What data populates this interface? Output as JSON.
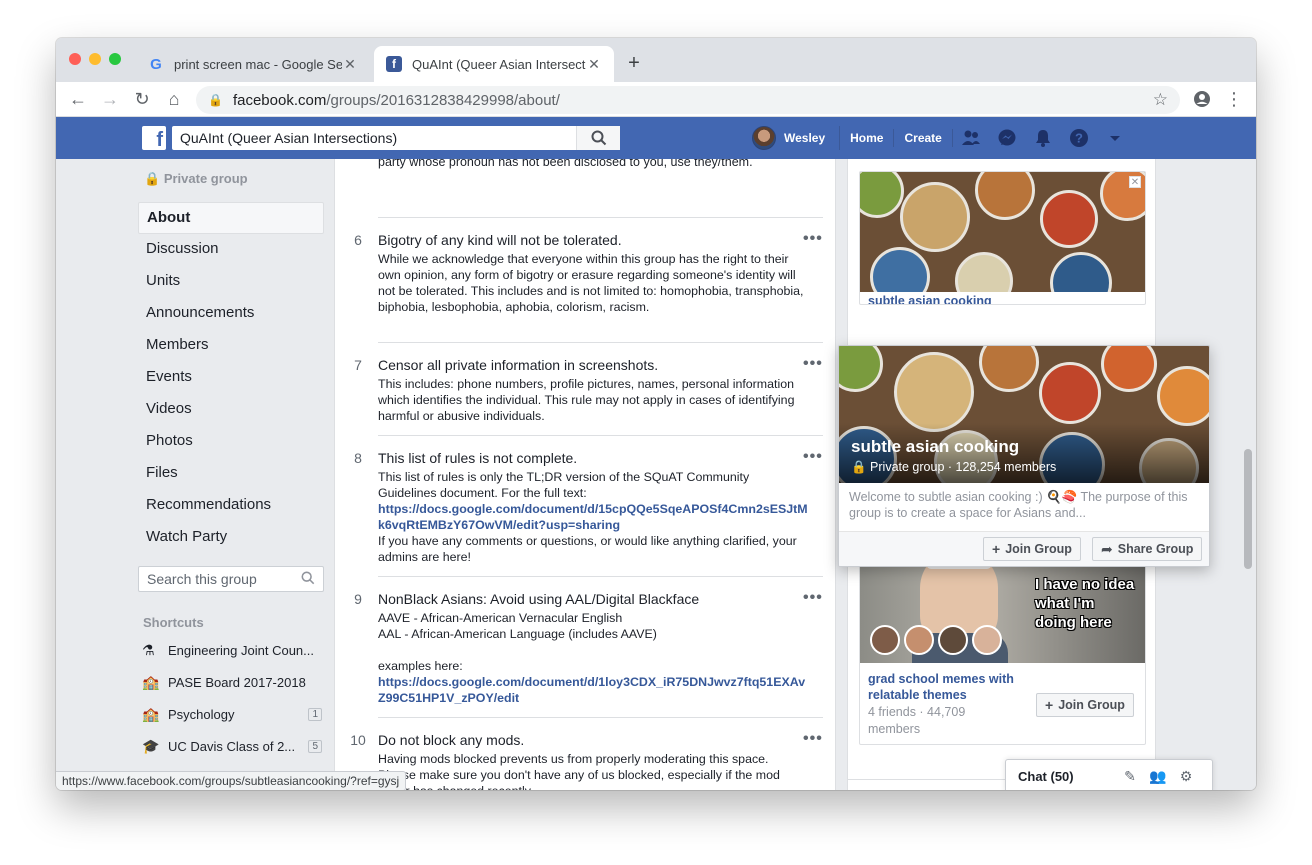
{
  "browser": {
    "tabs": [
      {
        "title": "print screen mac - Google Sear",
        "icon": "google-g-icon",
        "active": false
      },
      {
        "title": "QuAInt (Queer Asian Intersecti",
        "icon": "facebook-icon",
        "active": true
      }
    ],
    "url_host": "facebook.com",
    "url_path": "/groups/2016312838429998/about/",
    "status_url": "https://www.facebook.com/groups/subtleasiancooking/?ref=gysj"
  },
  "fb_header": {
    "search_value": "QuAInt (Queer Asian Intersections)",
    "user_name": "Wesley",
    "home": "Home",
    "create": "Create"
  },
  "left": {
    "private_label": "Private group",
    "nav": [
      "About",
      "Discussion",
      "Units",
      "Announcements",
      "Members",
      "Events",
      "Videos",
      "Photos",
      "Files",
      "Recommendations",
      "Watch Party"
    ],
    "search_placeholder": "Search this group",
    "shortcuts_heading": "Shortcuts",
    "shortcuts": [
      {
        "icon": "flask-icon",
        "label": "Engineering Joint Coun...",
        "count": ""
      },
      {
        "icon": "school-icon",
        "label": "PASE Board 2017-2018",
        "count": ""
      },
      {
        "icon": "school-icon",
        "label": "Psychology",
        "count": "1"
      },
      {
        "icon": "graduation-cap-icon",
        "label": "UC Davis Class of 2...",
        "count": "5"
      }
    ]
  },
  "rules": {
    "cut_text": "party whose pronoun has not been disclosed to you, use they/them.",
    "items": [
      {
        "num": "6",
        "title": "Bigotry of any kind will not be tolerated.",
        "body": "While we acknowledge that everyone within this group has the right to their own opinion, any form of bigotry or erasure regarding someone's identity will not be tolerated. This includes and is not limited to: homophobia, transphobia, biphobia, lesbophobia, aphobia, colorism, racism."
      },
      {
        "num": "7",
        "title": "Censor all private information in screenshots.",
        "body": "This includes: phone numbers, profile pictures, names, personal information which identifies the individual. This rule may not apply in cases of identifying harmful or abusive individuals."
      },
      {
        "num": "8",
        "title": "This list of rules is not complete.",
        "body_pre": "This list of rules is only the TL;DR version of the SQuAT Community Guidelines document. For the full text:",
        "link": "https://docs.google.com/document/d/15cpQQe5SqeAPOSf4Cmn2sESJtMk6vqRtEMBzY67OwVM/edit?usp=sharing",
        "body_post": "If you have any comments or questions, or would like anything clarified, your admins are here!"
      },
      {
        "num": "9",
        "title": "NonBlack Asians: Avoid using AAL/Digital Blackface",
        "line1": "AAVE - African-American Vernacular English",
        "line2": "AAL - African-American Language (includes AAVE)",
        "line3": "examples here:",
        "link": "https://docs.google.com/document/d/1loy3CDX_iR75DNJwvz7ftq51EXAvZ99C51HP1V_zPOY/edit"
      },
      {
        "num": "10",
        "title": "Do not block any mods.",
        "body": "Having mods blocked prevents us from properly moderating this space. Please make sure you don't have any of us blocked, especially if the mod roster has changed recently."
      }
    ]
  },
  "hovercard": {
    "name": "subtle asian cooking",
    "meta": "Private group · 128,254 members",
    "desc": "Welcome to subtle asian cooking :) 🍳🍣 The purpose of this group is to create a space for Asians and...",
    "join": "Join Group",
    "share": "Share Group"
  },
  "ad1": {
    "peek_text": "subtle asian cooking"
  },
  "ad2": {
    "name": "grad school memes with relatable themes",
    "meta": "4 friends · 44,709 members",
    "meme_text": "I have no idea what I'm doing here",
    "join": "Join Group"
  },
  "chat": {
    "label": "Chat (50)"
  },
  "colors": {
    "fb_blue": "#4267b2",
    "link": "#365899"
  }
}
